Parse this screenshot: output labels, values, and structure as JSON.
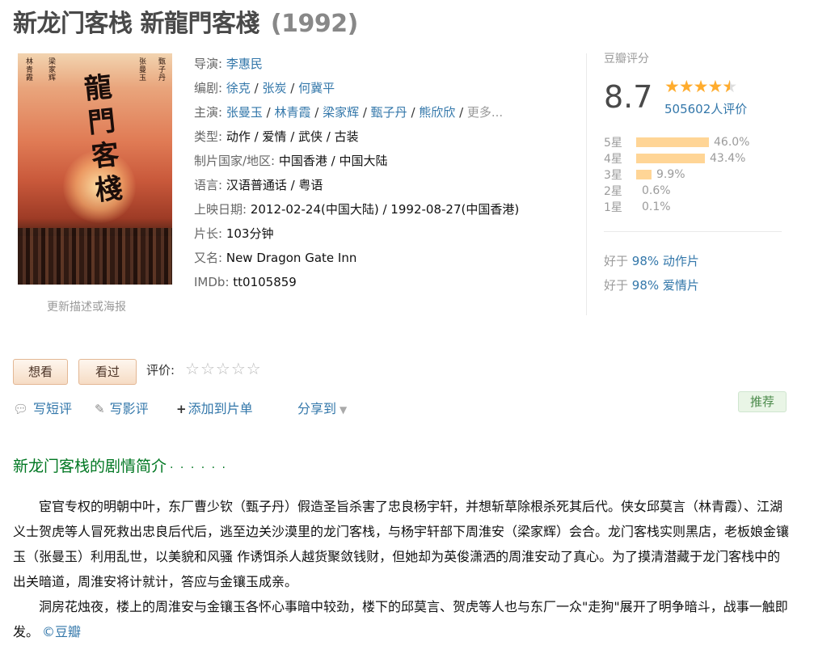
{
  "title": {
    "main": "新龙门客栈 新龍門客棧",
    "year": "(1992)"
  },
  "poster": {
    "title_chars": [
      "龍",
      "門",
      "客",
      "棧"
    ],
    "update_link": "更新描述或海报"
  },
  "info": {
    "director_label": "导演:",
    "directors": [
      "李惠民"
    ],
    "writer_label": "编剧:",
    "writers": [
      "徐克",
      "张炭",
      "何冀平"
    ],
    "cast_label": "主演:",
    "cast": [
      "张曼玉",
      "林青霞",
      "梁家辉",
      "甄子丹",
      "熊欣欣"
    ],
    "cast_more": "更多...",
    "genre_label": "类型:",
    "genre": "动作 / 爱情 / 武侠 / 古装",
    "country_label": "制片国家/地区:",
    "country": "中国香港 / 中国大陆",
    "language_label": "语言:",
    "language": "汉语普通话 / 粤语",
    "release_label": "上映日期:",
    "release": "2012-02-24(中国大陆) / 1992-08-27(中国香港)",
    "runtime_label": "片长:",
    "runtime": "103分钟",
    "aka_label": "又名:",
    "aka": "New Dragon Gate Inn",
    "imdb_label": "IMDb:",
    "imdb": "tt0105859"
  },
  "rating": {
    "head": "豆瓣评分",
    "score": "8.7",
    "stars_filled": 4.5,
    "count": "505602人评价",
    "distribution": [
      {
        "label": "5星",
        "pct": "46.0%",
        "value": 46.0
      },
      {
        "label": "4星",
        "pct": "43.4%",
        "value": 43.4
      },
      {
        "label": "3星",
        "pct": "9.9%",
        "value": 9.9
      },
      {
        "label": "2星",
        "pct": "0.6%",
        "value": 0.6
      },
      {
        "label": "1星",
        "pct": "0.1%",
        "value": 0.1
      }
    ],
    "better_than": [
      {
        "prefix": "好于",
        "pct": "98%",
        "genre": "动作片"
      },
      {
        "prefix": "好于",
        "pct": "98%",
        "genre": "爱情片"
      }
    ]
  },
  "interest": {
    "want_label": "想看",
    "seen_label": "看过",
    "rate_label": "评价:"
  },
  "actions": {
    "short_comment": "写短评",
    "review": "写影评",
    "add_list": "添加到片单",
    "share": "分享到",
    "recommend": "推荐"
  },
  "summary": {
    "title": "新龙门客栈的剧情简介",
    "dots": "· · · · · ·",
    "paragraph1": "宦官专权的明朝中叶，东厂曹少钦（甄子丹）假造圣旨杀害了忠良杨宇轩，并想斩草除根杀死其后代。侠女邱莫言（林青霞）、江湖义士贺虎等人冒死救出忠良后代后，逃至边关沙漠里的龙门客栈，与杨宇轩部下周淮安（梁家辉）会合。龙门客栈实则黑店，老板娘金镶玉（张曼玉）利用乱世，以美貌和风骚 作诱饵杀人越货聚敛钱财，但她却为英俊潇洒的周淮安动了真心。为了摸清潜藏于龙门客栈中的出关暗道，周淮安将计就计，答应与金镶玉成亲。",
    "paragraph2": "洞房花烛夜，楼上的周淮安与金镶玉各怀心事暗中较劲，楼下的邱莫言、贺虎等人也与东厂一众\"走狗\"展开了明争暗斗，战事一触即发。",
    "copyright": "©豆瓣"
  }
}
